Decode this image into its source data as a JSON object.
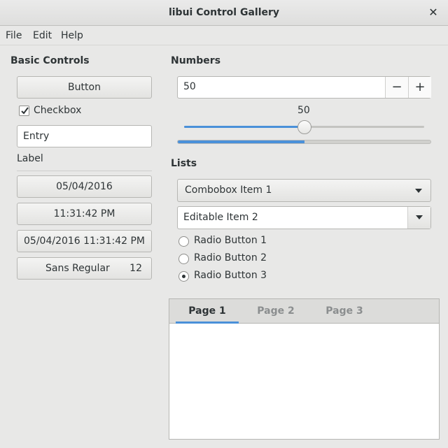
{
  "window": {
    "title": "libui Control Gallery",
    "close_label": "✕"
  },
  "menu": [
    "File",
    "Edit",
    "Help"
  ],
  "basic": {
    "title": "Basic Controls",
    "button_label": "Button",
    "checkbox_label": "Checkbox",
    "checkbox_checked": true,
    "entry_value": "Entry",
    "label_text": "Label",
    "date_label": "05/04/2016",
    "time_label": "11:31:42 PM",
    "datetime_label": "05/04/2016 11:31:42 PM",
    "font_name": "Sans Regular",
    "font_size": "12"
  },
  "numbers": {
    "title": "Numbers",
    "spinbox_value": "50",
    "minus_label": "−",
    "plus_label": "+",
    "slider_value_label": "50",
    "slider_fraction": 0.5,
    "progress_fraction": 0.5
  },
  "lists": {
    "title": "Lists",
    "combobox_selected": "Combobox Item 1",
    "editable_combobox_value": "Editable Item 2",
    "radios": [
      {
        "label": "Radio Button 1",
        "selected": false
      },
      {
        "label": "Radio Button 2",
        "selected": false
      },
      {
        "label": "Radio Button 3",
        "selected": true
      }
    ]
  },
  "tabs": [
    "Page 1",
    "Page 2",
    "Page 3"
  ],
  "active_tab": 0,
  "colors": {
    "accent": "#4a90d9",
    "background": "#e8e8e7"
  }
}
